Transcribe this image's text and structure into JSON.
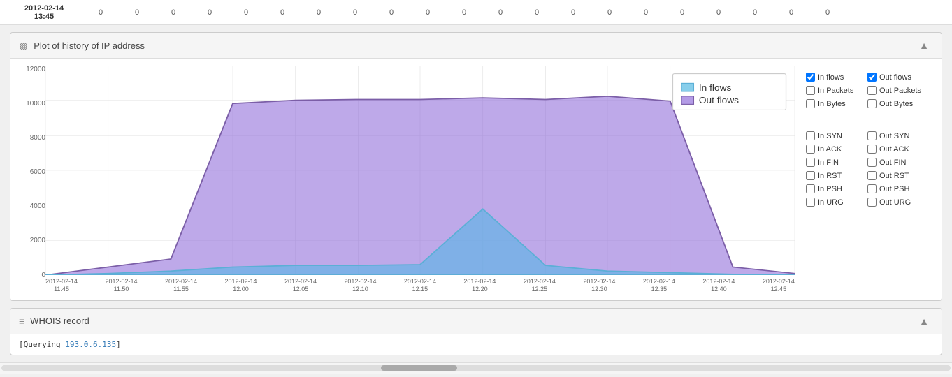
{
  "header": {
    "date": "2012-02-14",
    "time": "13:45",
    "numbers": [
      "0",
      "0",
      "0",
      "0",
      "0",
      "0",
      "0",
      "0",
      "0",
      "0",
      "0",
      "0",
      "0",
      "0",
      "0",
      "0",
      "0",
      "0",
      "0",
      "0",
      "0"
    ]
  },
  "chart_panel": {
    "title": "Plot of history of IP address",
    "icon": "bar-chart-icon",
    "collapse_label": "▲"
  },
  "legend": {
    "inline_items": [
      {
        "label": "In flows",
        "color": "#87ceeb"
      },
      {
        "label": "Out flows",
        "color": "#9370db"
      }
    ]
  },
  "checkboxes": {
    "row1": [
      {
        "id": "in_flows",
        "label": "In flows",
        "checked": true
      },
      {
        "id": "out_flows",
        "label": "Out flows",
        "checked": true
      }
    ],
    "row2": [
      {
        "id": "in_packets",
        "label": "In Packets",
        "checked": false
      },
      {
        "id": "out_packets",
        "label": "Out Packets",
        "checked": false
      }
    ],
    "row3": [
      {
        "id": "in_bytes",
        "label": "In Bytes",
        "checked": false
      },
      {
        "id": "out_bytes",
        "label": "Out Bytes",
        "checked": false
      }
    ],
    "row4": [
      {
        "id": "in_syn",
        "label": "In SYN",
        "checked": false
      },
      {
        "id": "out_syn",
        "label": "Out SYN",
        "checked": false
      }
    ],
    "row5": [
      {
        "id": "in_ack",
        "label": "In ACK",
        "checked": false
      },
      {
        "id": "out_ack",
        "label": "Out ACK",
        "checked": false
      }
    ],
    "row6": [
      {
        "id": "in_fin",
        "label": "In FIN",
        "checked": false
      },
      {
        "id": "out_fin",
        "label": "Out FIN",
        "checked": false
      }
    ],
    "row7": [
      {
        "id": "in_rst",
        "label": "In RST",
        "checked": false
      },
      {
        "id": "out_rst",
        "label": "Out RST",
        "checked": false
      }
    ],
    "row8": [
      {
        "id": "in_psh",
        "label": "In PSH",
        "checked": false
      },
      {
        "id": "out_psh",
        "label": "Out PSH",
        "checked": false
      }
    ],
    "row9": [
      {
        "id": "in_urg",
        "label": "In URG",
        "checked": false
      },
      {
        "id": "out_urg",
        "label": "Out URG",
        "checked": false
      }
    ]
  },
  "y_axis": [
    "12000",
    "10000",
    "8000",
    "6000",
    "4000",
    "2000",
    "0"
  ],
  "x_axis": [
    "2012-02-14\n11:45",
    "2012-02-14\n11:50",
    "2012-02-14\n11:55",
    "2012-02-14\n12:00",
    "2012-02-14\n12:05",
    "2012-02-14\n12:10",
    "2012-02-14\n12:15",
    "2012-02-14\n12:20",
    "2012-02-14\n12:25",
    "2012-02-14\n12:30",
    "2012-02-14\n12:35",
    "2012-02-14\n12:40",
    "2012-02-14\n12:45"
  ],
  "whois_panel": {
    "title": "WHOIS record",
    "icon": "list-icon",
    "collapse_label": "▲",
    "content": "[Querying 193.0.6.135]"
  }
}
